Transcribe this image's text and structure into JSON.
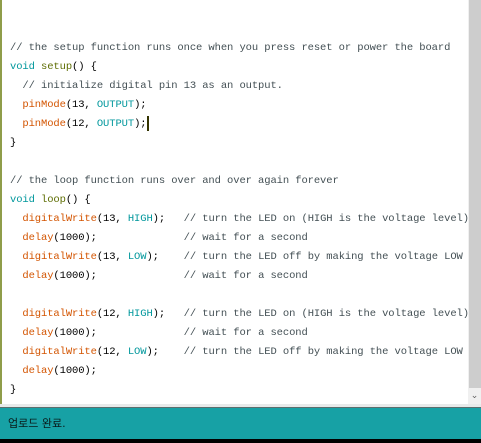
{
  "editor": {
    "lines": [
      [
        {
          "t": "comment",
          "s": "// the setup function runs once when you press reset or power the board"
        }
      ],
      [
        {
          "t": "keyword",
          "s": "void"
        },
        {
          "t": "plain",
          "s": " "
        },
        {
          "t": "func",
          "s": "setup"
        },
        {
          "t": "plain",
          "s": "() {"
        }
      ],
      [
        {
          "t": "comment",
          "s": "  // initialize digital pin 13 as an output."
        }
      ],
      [
        {
          "t": "plain",
          "s": "  "
        },
        {
          "t": "builtin",
          "s": "pinMode"
        },
        {
          "t": "plain",
          "s": "(13, "
        },
        {
          "t": "const",
          "s": "OUTPUT"
        },
        {
          "t": "plain",
          "s": ");"
        }
      ],
      [
        {
          "t": "plain",
          "s": "  "
        },
        {
          "t": "builtin",
          "s": "pinMode"
        },
        {
          "t": "plain",
          "s": "(12, "
        },
        {
          "t": "const",
          "s": "OUTPUT"
        },
        {
          "t": "plain",
          "s": ");"
        },
        {
          "t": "cursor",
          "s": ""
        }
      ],
      [
        {
          "t": "plain",
          "s": "}"
        }
      ],
      [],
      [
        {
          "t": "comment",
          "s": "// the loop function runs over and over again forever"
        }
      ],
      [
        {
          "t": "keyword",
          "s": "void"
        },
        {
          "t": "plain",
          "s": " "
        },
        {
          "t": "func",
          "s": "loop"
        },
        {
          "t": "plain",
          "s": "() {"
        }
      ],
      [
        {
          "t": "plain",
          "s": "  "
        },
        {
          "t": "builtin",
          "s": "digitalWrite"
        },
        {
          "t": "plain",
          "s": "(13, "
        },
        {
          "t": "const",
          "s": "HIGH"
        },
        {
          "t": "plain",
          "s": ");   "
        },
        {
          "t": "comment",
          "s": "// turn the LED on (HIGH is the voltage level)"
        }
      ],
      [
        {
          "t": "plain",
          "s": "  "
        },
        {
          "t": "builtin",
          "s": "delay"
        },
        {
          "t": "plain",
          "s": "(1000);              "
        },
        {
          "t": "comment",
          "s": "// wait for a second"
        }
      ],
      [
        {
          "t": "plain",
          "s": "  "
        },
        {
          "t": "builtin",
          "s": "digitalWrite"
        },
        {
          "t": "plain",
          "s": "(13, "
        },
        {
          "t": "const",
          "s": "LOW"
        },
        {
          "t": "plain",
          "s": ");    "
        },
        {
          "t": "comment",
          "s": "// turn the LED off by making the voltage LOW"
        }
      ],
      [
        {
          "t": "plain",
          "s": "  "
        },
        {
          "t": "builtin",
          "s": "delay"
        },
        {
          "t": "plain",
          "s": "(1000);              "
        },
        {
          "t": "comment",
          "s": "// wait for a second"
        }
      ],
      [],
      [
        {
          "t": "plain",
          "s": "  "
        },
        {
          "t": "builtin",
          "s": "digitalWrite"
        },
        {
          "t": "plain",
          "s": "(12, "
        },
        {
          "t": "const",
          "s": "HIGH"
        },
        {
          "t": "plain",
          "s": ");   "
        },
        {
          "t": "comment",
          "s": "// turn the LED on (HIGH is the voltage level)"
        }
      ],
      [
        {
          "t": "plain",
          "s": "  "
        },
        {
          "t": "builtin",
          "s": "delay"
        },
        {
          "t": "plain",
          "s": "(1000);              "
        },
        {
          "t": "comment",
          "s": "// wait for a second"
        }
      ],
      [
        {
          "t": "plain",
          "s": "  "
        },
        {
          "t": "builtin",
          "s": "digitalWrite"
        },
        {
          "t": "plain",
          "s": "(12, "
        },
        {
          "t": "const",
          "s": "LOW"
        },
        {
          "t": "plain",
          "s": ");    "
        },
        {
          "t": "comment",
          "s": "// turn the LED off by making the voltage LOW"
        }
      ],
      [
        {
          "t": "plain",
          "s": "  "
        },
        {
          "t": "builtin",
          "s": "delay"
        },
        {
          "t": "plain",
          "s": "(1000);"
        }
      ],
      [
        {
          "t": "plain",
          "s": "}"
        }
      ]
    ]
  },
  "scrollbar": {
    "down_icon": "chevron-down-icon",
    "down_glyph": "⌄"
  },
  "status": {
    "message": "업로드 완료."
  },
  "colors": {
    "status_bg": "#17a1a5",
    "keyword": "#00979c",
    "builtin": "#d35400",
    "func": "#5e6d03"
  }
}
